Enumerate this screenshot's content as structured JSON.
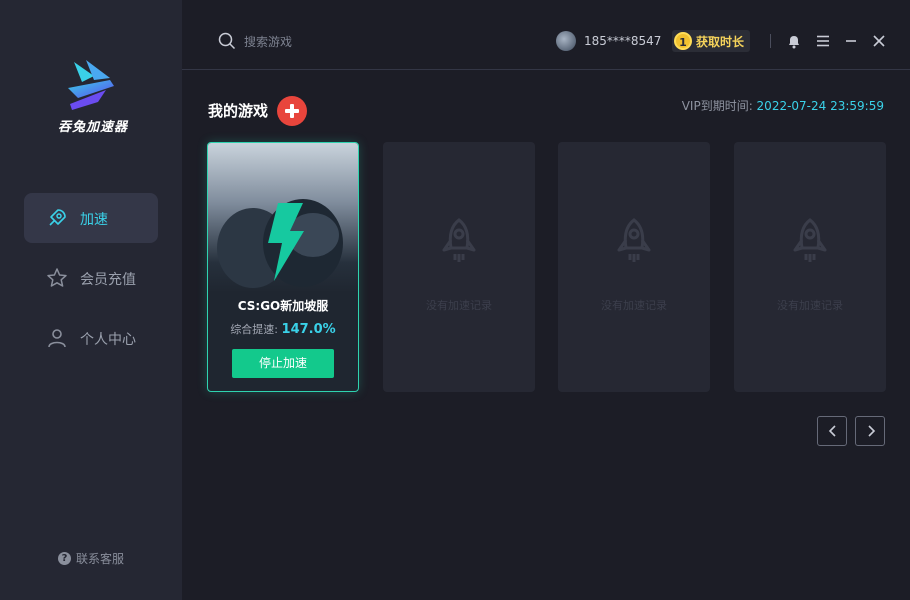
{
  "app": {
    "name": "吞兔加速器"
  },
  "sidebar": {
    "items": [
      {
        "label": "加速",
        "icon": "rocket-icon",
        "active": true
      },
      {
        "label": "会员充值",
        "icon": "star-icon",
        "active": false
      },
      {
        "label": "个人中心",
        "icon": "user-icon",
        "active": false
      }
    ],
    "support_label": "联系客服"
  },
  "header": {
    "search_placeholder": "搜索游戏",
    "phone": "185****8547",
    "get_time_label": "获取时长",
    "coin_badge": "1"
  },
  "main": {
    "title": "我的游戏",
    "vip_label": "VIP到期时间: ",
    "vip_date": "2022-07-24 23:59:59",
    "active_game": {
      "name": "CS:GO新加坡服",
      "boost_label": "综合提速:",
      "boost_value": "147.0%",
      "stop_label": "停止加速"
    },
    "empty_slots": [
      {
        "text": "没有加速记录"
      },
      {
        "text": "没有加速记录"
      },
      {
        "text": "没有加速记录"
      }
    ]
  },
  "colors": {
    "accent": "#3ad1e8",
    "green": "#13c98c",
    "red": "#e8453c",
    "gold": "#f5d35b"
  }
}
